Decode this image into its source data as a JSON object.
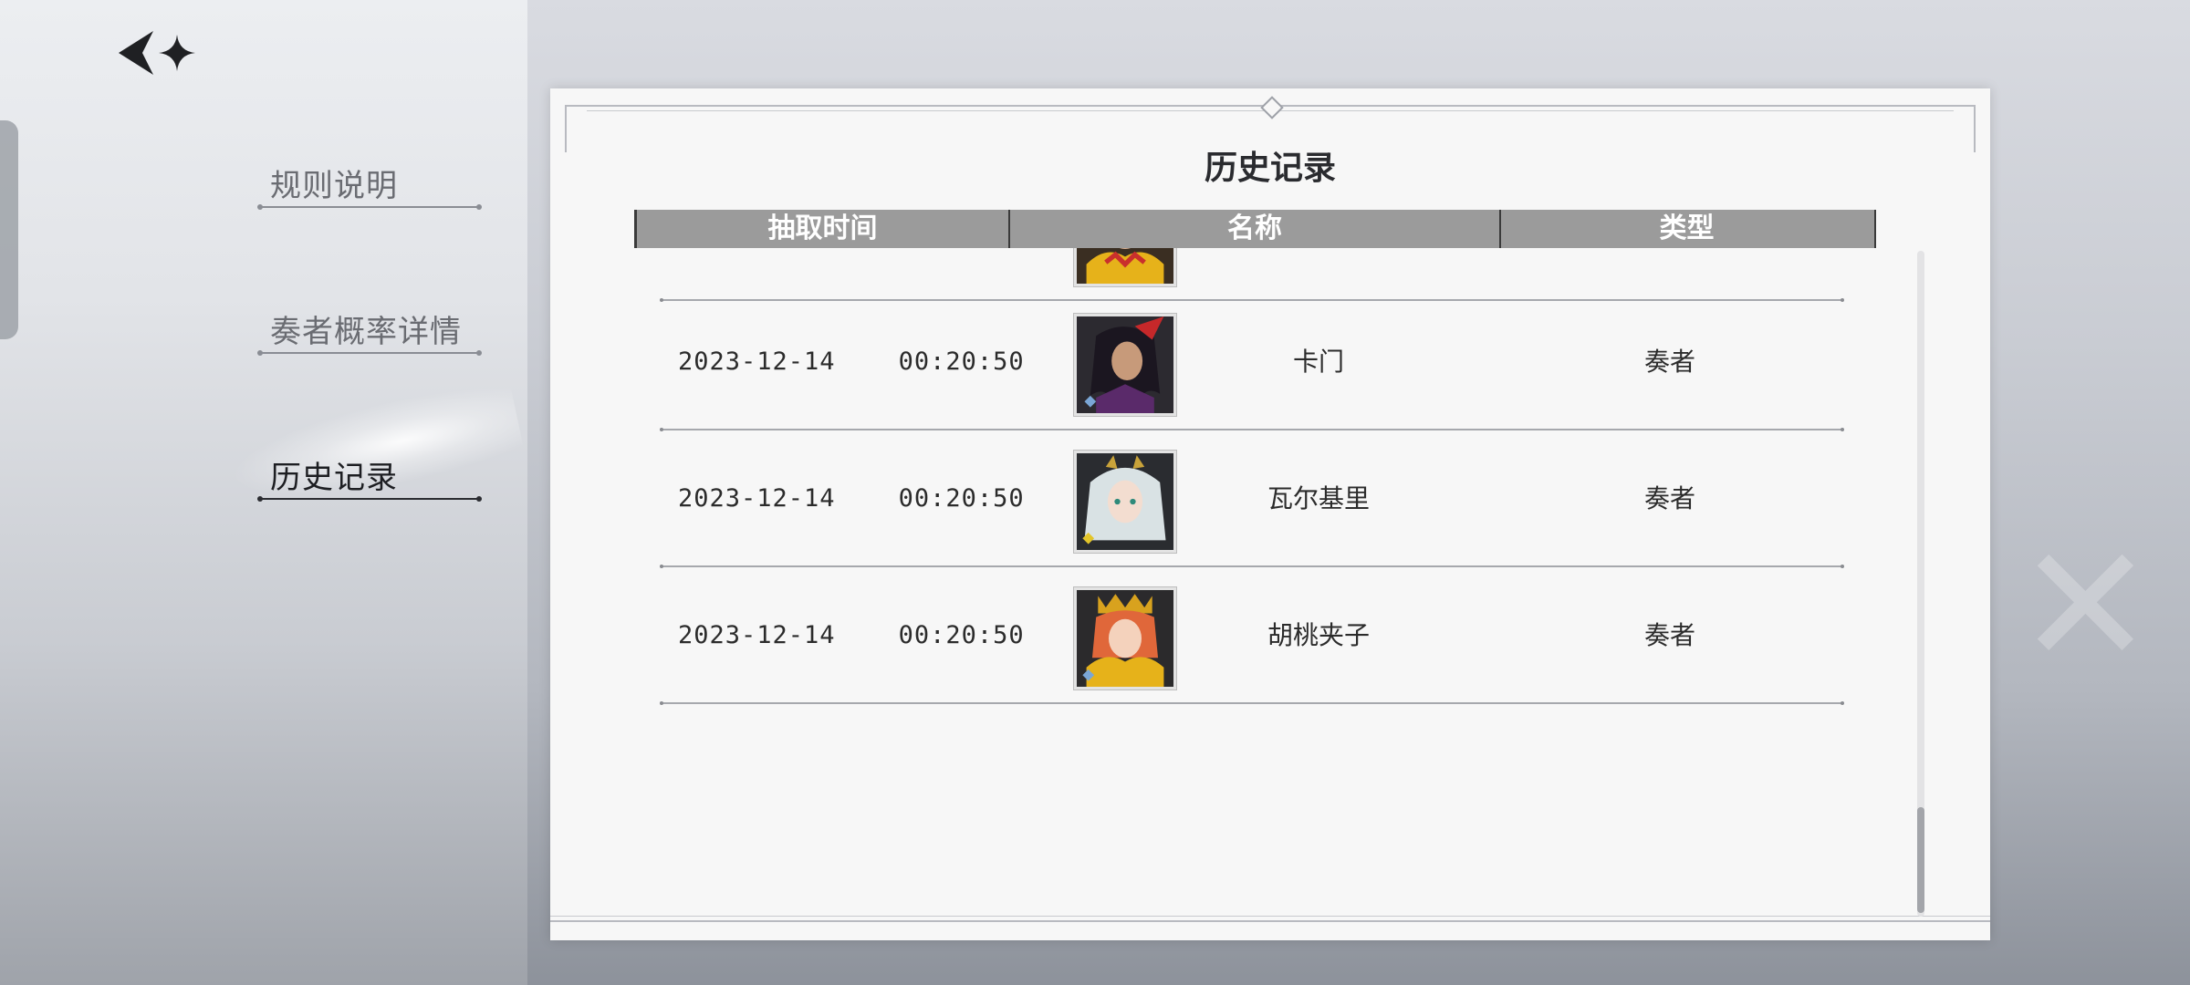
{
  "nav": {
    "items": [
      {
        "label": "规则说明",
        "active": false
      },
      {
        "label": "奏者概率详情",
        "active": false
      },
      {
        "label": "历史记录",
        "active": true
      }
    ]
  },
  "card": {
    "title": "历史记录",
    "columns": [
      "抽取时间",
      "名称",
      "类型"
    ]
  },
  "rows": [
    {
      "time": "2023-12-14    00:20:50",
      "name": "卡门",
      "type": "奏者",
      "avatar": "character-avatar-dark-haired"
    },
    {
      "time": "2023-12-14    00:20:50",
      "name": "瓦尔基里",
      "type": "奏者",
      "avatar": "character-avatar-silver-haired"
    },
    {
      "time": "2023-12-14    00:20:50",
      "name": "胡桃夹子",
      "type": "奏者",
      "avatar": "character-avatar-red-haired"
    }
  ],
  "icons": {
    "back": "back-arrow-star-icon"
  },
  "colors": {
    "header_bg": "#9b9b9b",
    "card_bg": "#f7f7f7",
    "active_text": "#1d1e22",
    "inactive_text": "#6a6c72"
  }
}
